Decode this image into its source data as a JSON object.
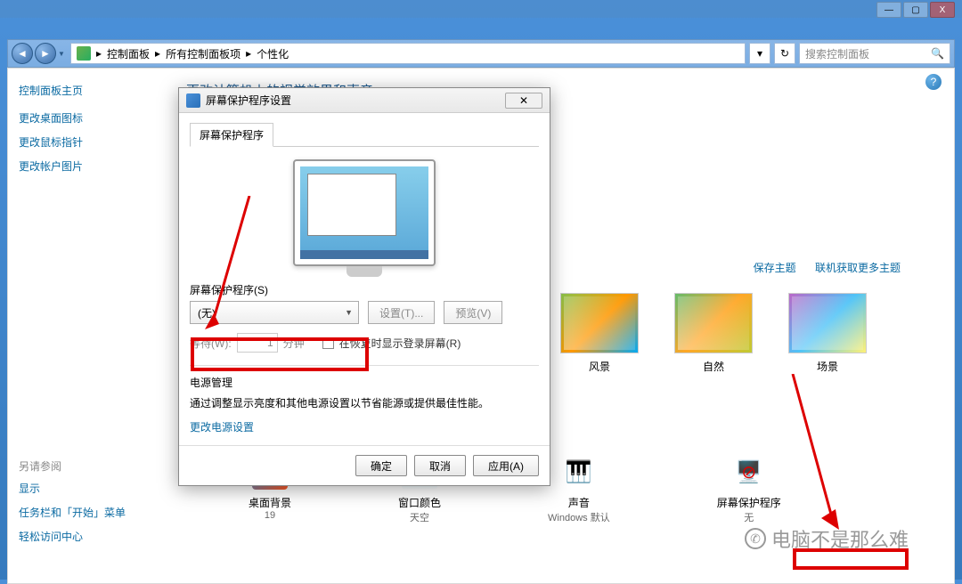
{
  "window_controls": {
    "min": "—",
    "max": "▢",
    "close": "X"
  },
  "breadcrumb": {
    "item1": "控制面板",
    "item2": "所有控制面板项",
    "item3": "个性化",
    "sep": "▸"
  },
  "search": {
    "placeholder": "搜索控制面板"
  },
  "sidebar": {
    "home": "控制面板主页",
    "tasks": [
      "更改桌面图标",
      "更改鼠标指针",
      "更改帐户图片"
    ],
    "see_also_label": "另请参阅",
    "see_also": [
      "显示",
      "任务栏和「开始」菜单",
      "轻松访问中心"
    ]
  },
  "page_title": "更改计算机上的视觉效果和声音",
  "theme_links": {
    "save": "保存主题",
    "more": "联机获取更多主题"
  },
  "themes": [
    "风景",
    "自然",
    "场景"
  ],
  "bottom_settings": [
    {
      "name": "桌面背景",
      "sub": "19"
    },
    {
      "name": "窗口颜色",
      "sub": "天空"
    },
    {
      "name": "声音",
      "sub": "Windows 默认"
    },
    {
      "name": "屏幕保护程序",
      "sub": "无"
    }
  ],
  "dialog": {
    "title": "屏幕保护程序设置",
    "tab": "屏幕保护程序",
    "section_label": "屏幕保护程序(S)",
    "dropdown_value": "(无)",
    "btn_settings": "设置(T)...",
    "btn_preview": "预览(V)",
    "wait_label": "等待(W):",
    "wait_value": "1",
    "wait_unit": "分钟",
    "resume_checkbox": "在恢复时显示登录屏幕(R)",
    "power_title": "电源管理",
    "power_desc": "通过调整显示亮度和其他电源设置以节省能源或提供最佳性能。",
    "power_link": "更改电源设置",
    "btn_ok": "确定",
    "btn_cancel": "取消",
    "btn_apply": "应用(A)"
  },
  "watermark": "电脑不是那么难"
}
